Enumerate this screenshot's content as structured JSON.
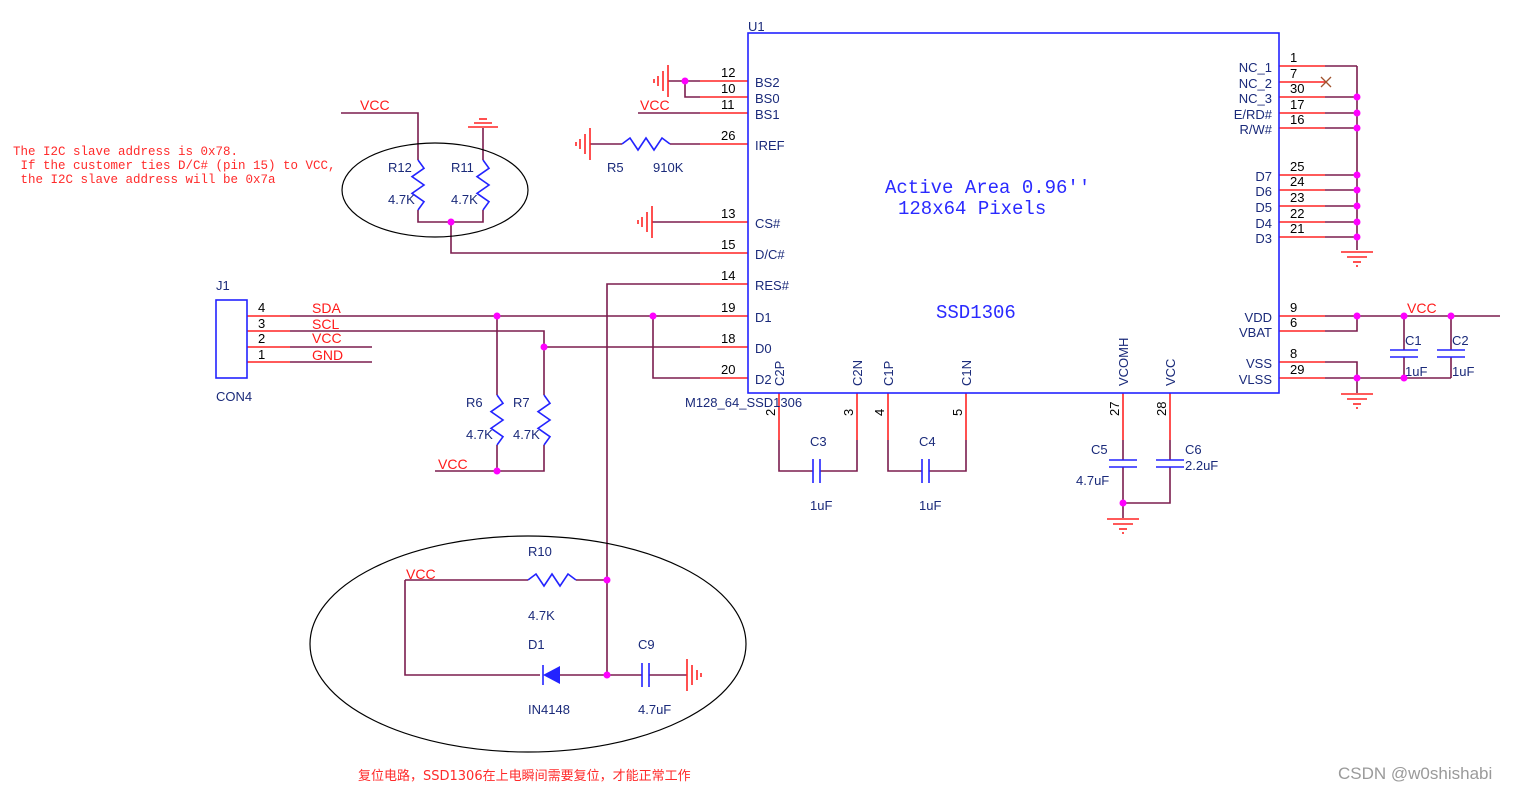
{
  "note": {
    "lines": [
      "The I2C slave address is 0x78.",
      " If the customer ties D/C# (pin 15) to VCC,",
      " the I2C slave address will be 0x7a"
    ],
    "reset_note": "复位电路，SSD1306在上电瞬间需要复位，才能正常工作"
  },
  "watermark": "CSDN @w0shishabi",
  "u1": {
    "ref": "U1",
    "part": "M128_64_SSD1306",
    "chip": "SSD1306",
    "active_area": "Active Area 0.96''",
    "pixels": "128x64 Pixels",
    "left_pins": [
      {
        "num": "12",
        "name": "BS2"
      },
      {
        "num": "10",
        "name": "BS0"
      },
      {
        "num": "11",
        "name": "BS1"
      },
      {
        "num": "26",
        "name": "IREF"
      },
      {
        "num": "13",
        "name": "CS#"
      },
      {
        "num": "15",
        "name": "D/C#"
      },
      {
        "num": "14",
        "name": "RES#"
      },
      {
        "num": "19",
        "name": "D1"
      },
      {
        "num": "18",
        "name": "D0"
      },
      {
        "num": "20",
        "name": "D2"
      }
    ],
    "right_pins": [
      {
        "num": "1",
        "name": "NC_1"
      },
      {
        "num": "7",
        "name": "NC_2"
      },
      {
        "num": "30",
        "name": "NC_3"
      },
      {
        "num": "17",
        "name": "E/RD#"
      },
      {
        "num": "16",
        "name": "R/W#"
      },
      {
        "num": "25",
        "name": "D7"
      },
      {
        "num": "24",
        "name": "D6"
      },
      {
        "num": "23",
        "name": "D5"
      },
      {
        "num": "22",
        "name": "D4"
      },
      {
        "num": "21",
        "name": "D3"
      },
      {
        "num": "9",
        "name": "VDD"
      },
      {
        "num": "6",
        "name": "VBAT"
      },
      {
        "num": "8",
        "name": "VSS"
      },
      {
        "num": "29",
        "name": "VLSS"
      }
    ],
    "bottom_pins": [
      {
        "num": "2",
        "name": "C2P"
      },
      {
        "num": "3",
        "name": "C2N"
      },
      {
        "num": "4",
        "name": "C1P"
      },
      {
        "num": "5",
        "name": "C1N"
      },
      {
        "num": "27",
        "name": "VCOMH"
      },
      {
        "num": "28",
        "name": "VCC"
      }
    ]
  },
  "j1": {
    "ref": "J1",
    "part": "CON4",
    "pins": [
      {
        "num": "4",
        "net": "SDA"
      },
      {
        "num": "3",
        "net": "SCL"
      },
      {
        "num": "2",
        "net": "VCC"
      },
      {
        "num": "1",
        "net": "GND"
      }
    ]
  },
  "components": {
    "R5": {
      "ref": "R5",
      "value": "910K"
    },
    "R12": {
      "ref": "R12",
      "value": "4.7K"
    },
    "R11": {
      "ref": "R11",
      "value": "4.7K"
    },
    "R6": {
      "ref": "R6",
      "value": "4.7K"
    },
    "R7": {
      "ref": "R7",
      "value": "4.7K"
    },
    "R10": {
      "ref": "R10",
      "value": "4.7K"
    },
    "D1": {
      "ref": "D1",
      "value": "IN4148"
    },
    "C9": {
      "ref": "C9",
      "value": "4.7uF"
    },
    "C3": {
      "ref": "C3",
      "value": "1uF"
    },
    "C4": {
      "ref": "C4",
      "value": "1uF"
    },
    "C5": {
      "ref": "C5",
      "value": "4.7uF"
    },
    "C6": {
      "ref": "C6",
      "value": "2.2uF"
    },
    "C1": {
      "ref": "C1",
      "value": "1uF"
    },
    "C2": {
      "ref": "C2",
      "value": "1uF"
    }
  },
  "nets": {
    "vcc": "VCC"
  },
  "colors": {
    "wire": "#7b1d4e",
    "pin": "#ff2424",
    "symbol": "#2323ff",
    "junction": "#ff00ff",
    "net_label": "#ff1a1a"
  }
}
